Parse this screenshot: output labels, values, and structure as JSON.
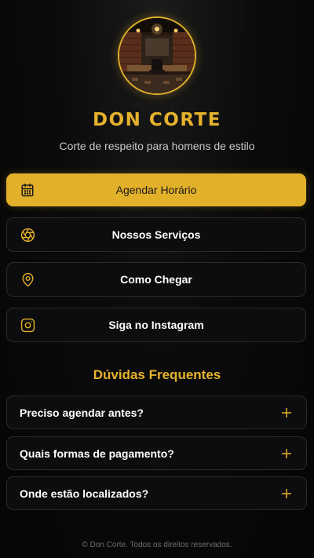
{
  "brand": {
    "title": "DON CORTE",
    "tagline": "Corte de respeito para homens de estilo"
  },
  "colors": {
    "accent": "#e3b02a",
    "background": "#0b0b0b",
    "card": "#0d0d0f",
    "card_border": "#2a2a2c"
  },
  "buttons": [
    {
      "label": "Agendar Horário",
      "icon": "calendar-icon",
      "primary": true
    },
    {
      "label": "Nossos Serviços",
      "icon": "aperture-icon",
      "primary": false
    },
    {
      "label": "Como Chegar",
      "icon": "map-pin-icon",
      "primary": false
    },
    {
      "label": "Siga no Instagram",
      "icon": "instagram-icon",
      "primary": false
    }
  ],
  "faq": {
    "heading": "Dúvidas Frequentes",
    "items": [
      {
        "question": "Preciso agendar antes?",
        "icon": "plus-icon"
      },
      {
        "question": "Quais formas de pagamento?",
        "icon": "plus-icon"
      },
      {
        "question": "Onde estão localizados?",
        "icon": "plus-icon"
      }
    ]
  },
  "footer": {
    "text": "© Don Corte. Todos os direitos reservados."
  }
}
